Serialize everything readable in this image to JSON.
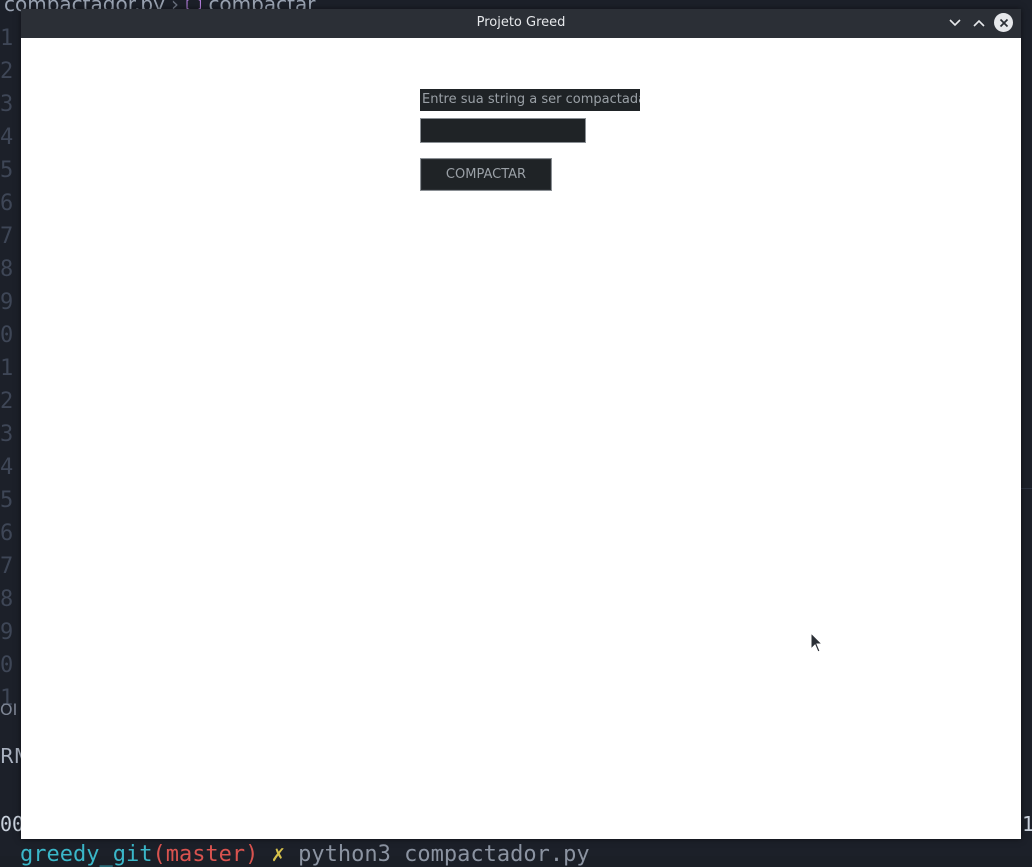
{
  "background": {
    "breadcrumb_file": "compactador.py",
    "breadcrumb_symbol": "compactar",
    "line_numbers": [
      "1",
      "2",
      "3",
      "4",
      "5",
      "6",
      "7",
      "8",
      "9",
      "0",
      "1",
      "2",
      "3",
      "4",
      "5",
      "6",
      "7",
      "8",
      "9",
      "0",
      "1"
    ],
    "panel_label_ob": "OI",
    "panel_label_rm": "RM",
    "terminal_left": "00",
    "terminal_right": "1",
    "terminal_line": {
      "part1": "greedy_git",
      "part2": "(master)",
      "part3": "✗",
      "part4": "python3 compactador.py"
    }
  },
  "window": {
    "title": "Projeto Greed",
    "minimize_icon": "chevron-down-icon",
    "maximize_icon": "chevron-up-icon",
    "close_icon": "close-icon"
  },
  "form": {
    "prompt_label": "Entre sua string a ser compactada:",
    "input_value": "",
    "button_label": "COMPACTAR"
  }
}
